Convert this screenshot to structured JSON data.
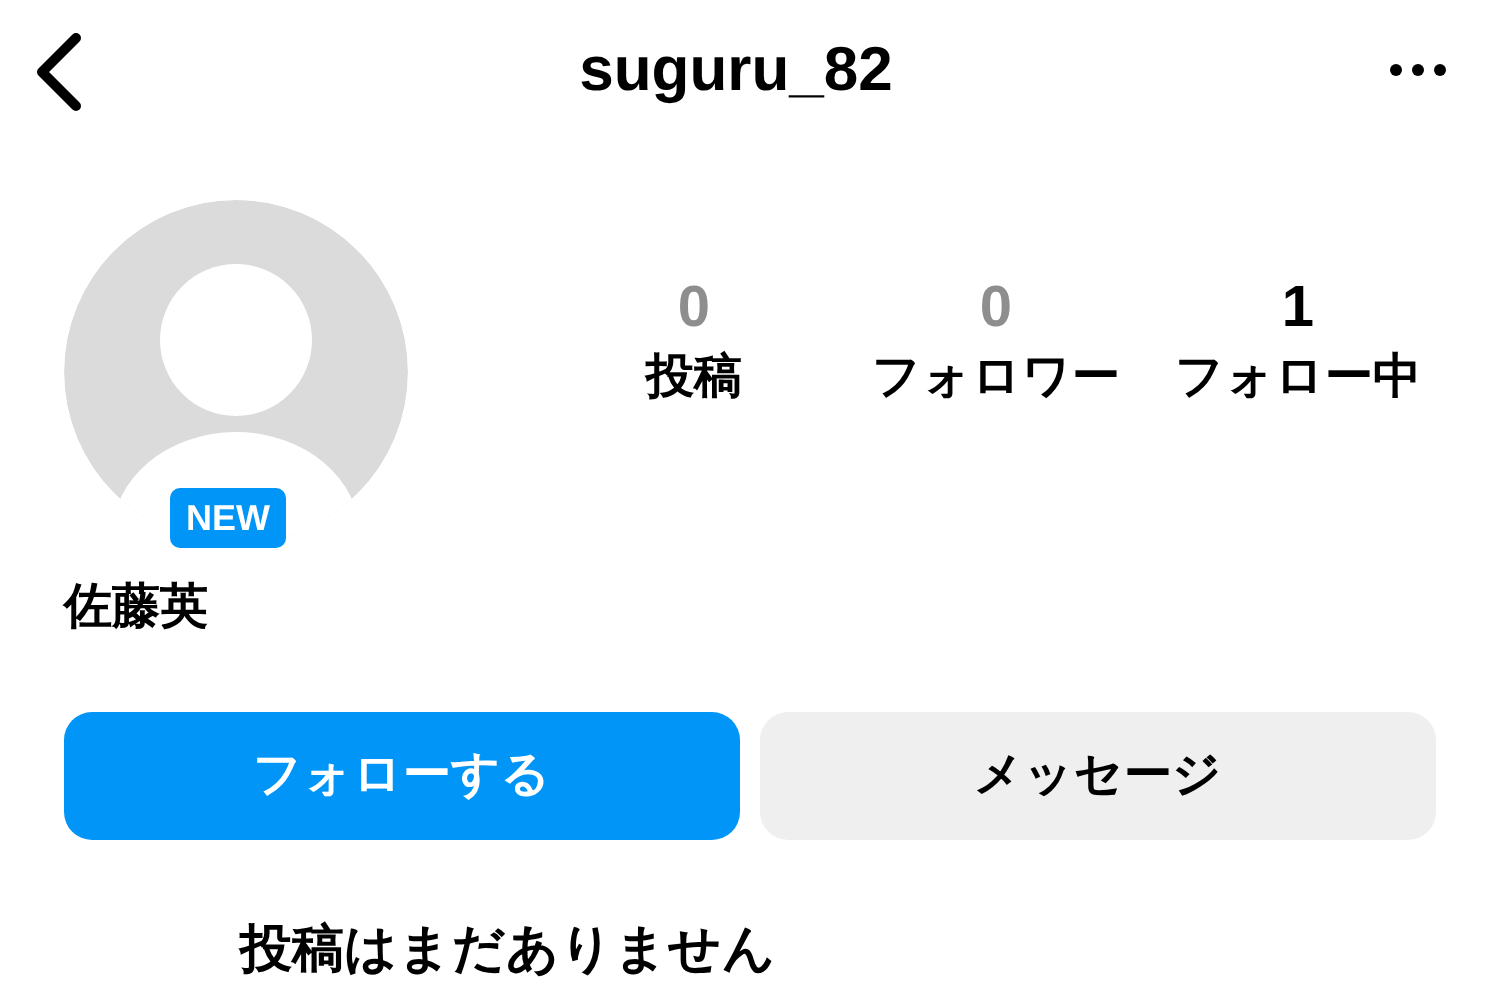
{
  "header": {
    "title": "suguru_82"
  },
  "profile": {
    "badge": "NEW",
    "name": "佐藤英"
  },
  "stats": [
    {
      "count": "0",
      "label": "投稿",
      "dimmed": true
    },
    {
      "count": "0",
      "label": "フォロワー",
      "dimmed": true
    },
    {
      "count": "1",
      "label": "フォロー中",
      "dimmed": false
    }
  ],
  "buttons": [
    {
      "label": "フォローする",
      "kind": "primary"
    },
    {
      "label": "メッセージ",
      "kind": "secondary"
    }
  ],
  "empty_message": "投稿はまだありません"
}
